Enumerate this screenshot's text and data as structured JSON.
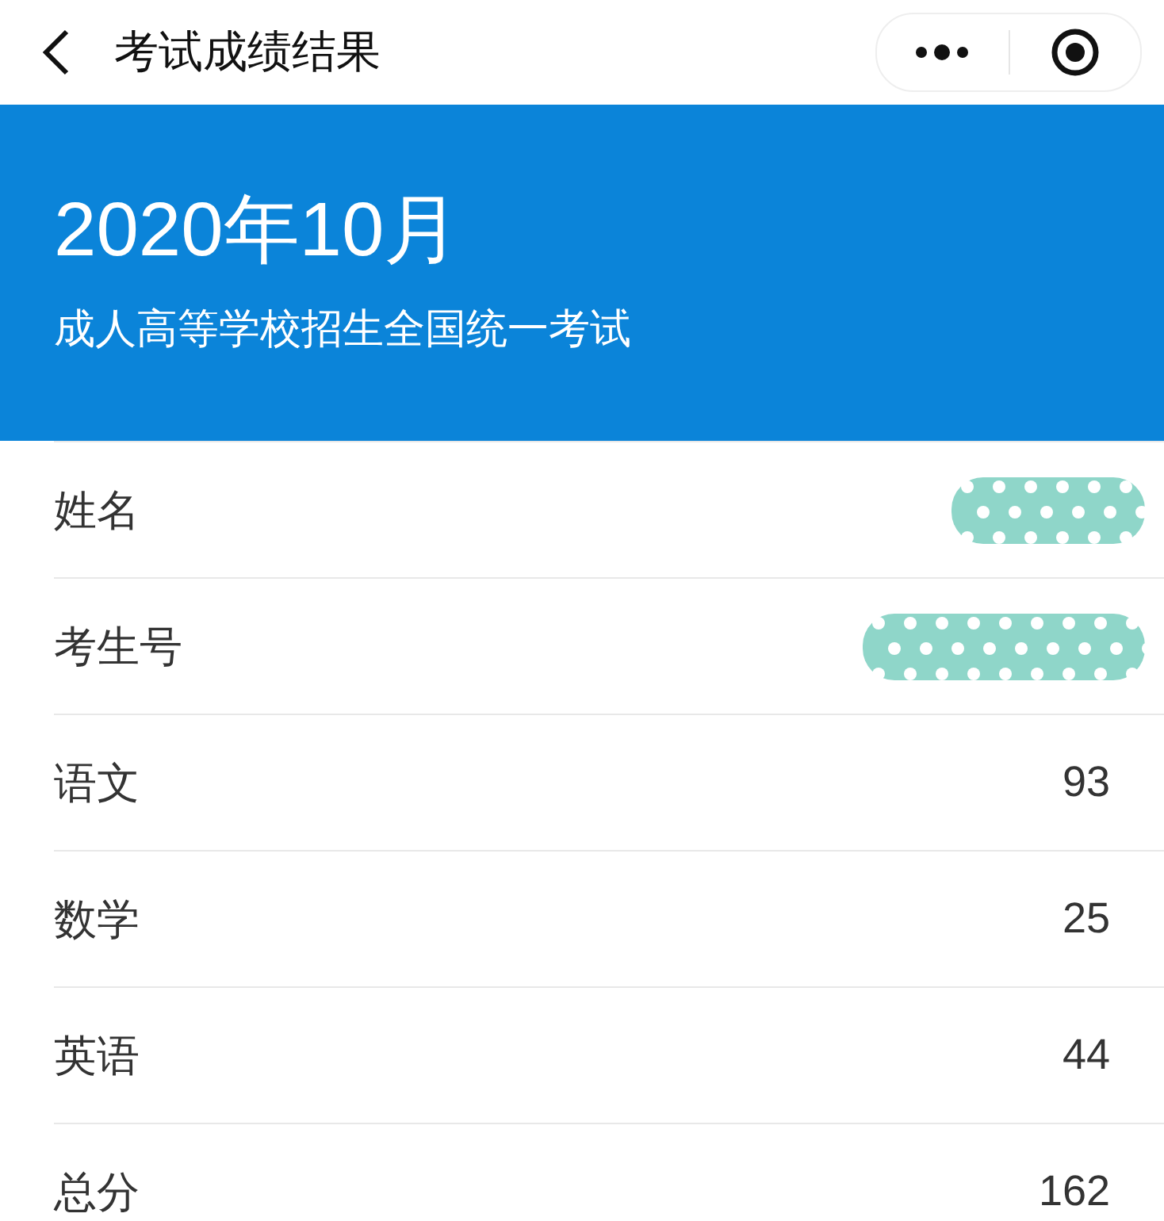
{
  "nav": {
    "title": "考试成绩结果"
  },
  "banner": {
    "heading": "2020年10月",
    "subtitle": "成人高等学校招生全国统一考试"
  },
  "rows": [
    {
      "label": "姓名",
      "redacted": true
    },
    {
      "label": "考生号",
      "redacted": true
    },
    {
      "label": "语文",
      "value": "93",
      "redacted": false
    },
    {
      "label": "数学",
      "value": "25",
      "redacted": false
    },
    {
      "label": "英语",
      "value": "44",
      "redacted": false
    },
    {
      "label": "总分",
      "value": "162",
      "redacted": false
    }
  ]
}
